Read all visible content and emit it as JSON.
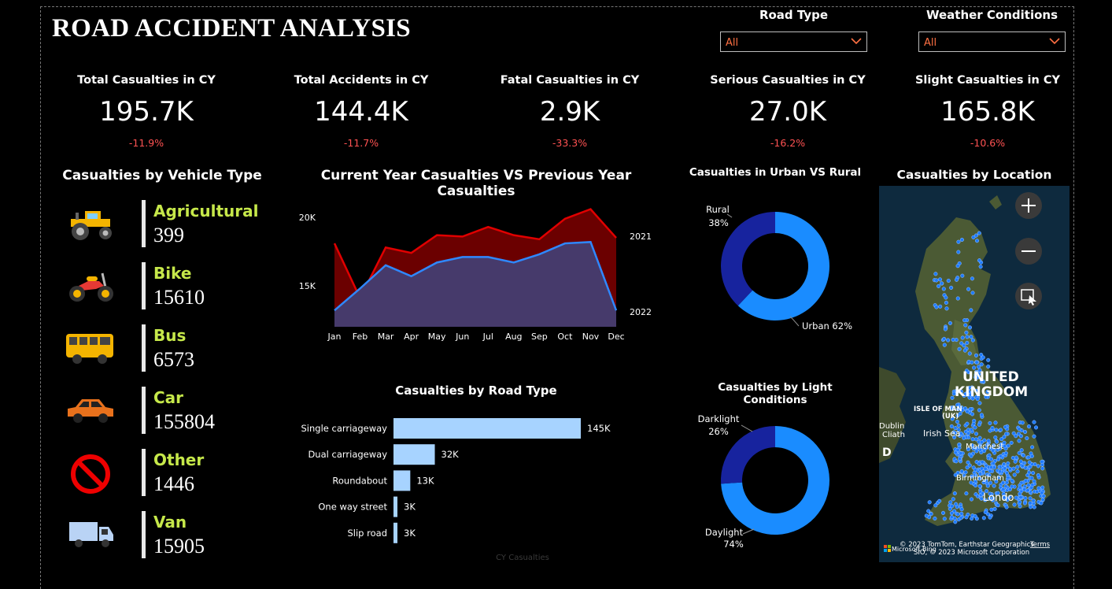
{
  "header": {
    "title": "ROAD ACCIDENT ANALYSIS"
  },
  "filters": [
    {
      "label": "Road Type",
      "value": "All"
    },
    {
      "label": "Weather Conditions",
      "value": "All"
    }
  ],
  "kpis": [
    {
      "label": "Total Casualties in CY",
      "value": "195.7K",
      "delta": "-11.9%"
    },
    {
      "label": "Total Accidents in CY",
      "value": "144.4K",
      "delta": "-11.7%"
    },
    {
      "label": "Fatal Casualties in CY",
      "value": "2.9K",
      "delta": "-33.3%"
    },
    {
      "label": "Serious Casualties in CY",
      "value": "27.0K",
      "delta": "-16.2%"
    },
    {
      "label": "Slight Casualties in CY",
      "value": "165.8K",
      "delta": "-10.6%"
    }
  ],
  "vehicles": {
    "title": "Casualties by Vehicle Type",
    "items": [
      {
        "name": "Agricultural",
        "value": "399",
        "icon": "tractor-icon"
      },
      {
        "name": "Bike",
        "value": "15610",
        "icon": "motorbike-icon"
      },
      {
        "name": "Bus",
        "value": "6573",
        "icon": "bus-icon"
      },
      {
        "name": "Car",
        "value": "155804",
        "icon": "car-icon"
      },
      {
        "name": "Other",
        "value": "1446",
        "icon": "prohibited-icon"
      },
      {
        "name": "Van",
        "value": "15905",
        "icon": "van-icon"
      }
    ]
  },
  "chart_data": [
    {
      "type": "area",
      "title": "Current Year Casualties VS Previous Year Casualties",
      "categories": [
        "Jan",
        "Feb",
        "Mar",
        "Apr",
        "May",
        "Jun",
        "Jul",
        "Aug",
        "Sep",
        "Oct",
        "Nov",
        "Dec"
      ],
      "series": [
        {
          "name": "2021",
          "color": "#e00000",
          "fill": "#6b0000",
          "values": [
            18100,
            14100,
            17800,
            17400,
            18700,
            18600,
            19300,
            18700,
            18400,
            19900,
            20600,
            18500
          ]
        },
        {
          "name": "2022",
          "color": "#2f88ff",
          "fill": "#463a6b",
          "values": [
            13200,
            14800,
            16500,
            15700,
            16700,
            17100,
            17100,
            16700,
            17300,
            18100,
            18200,
            13200
          ]
        }
      ],
      "y_ticks": [
        15000,
        20000
      ],
      "y_tick_labels": [
        "15K",
        "20K"
      ],
      "ylim": [
        12000,
        21500
      ]
    },
    {
      "type": "bar",
      "orientation": "horizontal",
      "title": "Casualties by Road Type",
      "categories": [
        "Single carriageway",
        "Dual carriageway",
        "Roundabout",
        "One way street",
        "Slip road"
      ],
      "values": [
        145000,
        32000,
        13000,
        3000,
        3000
      ],
      "value_labels": [
        "145K",
        "32K",
        "13K",
        "3K",
        "3K"
      ],
      "xlabel": "CY Casualties",
      "color": "#a7d3ff"
    },
    {
      "type": "pie",
      "donut": true,
      "title": "Casualties in Urban VS Rural",
      "slices": [
        {
          "label": "Urban",
          "value": 62,
          "label_text": "Urban 62%",
          "color": "#1a8cff"
        },
        {
          "label": "Rural",
          "value": 38,
          "label_text": "38%",
          "color": "#17239e"
        }
      ]
    },
    {
      "type": "pie",
      "donut": true,
      "title": "Casualties by Light Conditions",
      "slices": [
        {
          "label": "Daylight",
          "value": 74,
          "label_text": "74%",
          "color": "#1a8cff"
        },
        {
          "label": "Darklight",
          "value": 26,
          "label_text": "26%",
          "color": "#17239e"
        }
      ]
    }
  ],
  "map": {
    "title": "Casualties by Location",
    "labels": {
      "country": "UNITED",
      "country2": "KINGDOM",
      "isle": "ISLE OF MAN",
      "isle_sub": "(UK)",
      "dublin": "Dublin",
      "cliath": "Cliath",
      "irish_sea": "Irish Sea",
      "manchester": "Manchest",
      "birmingham": "Birmingham",
      "london": "Londo",
      "d": "D"
    },
    "attribution": "© 2023 TomTom, Earthstar Geographics",
    "attribution2": "SIO, © 2023 Microsoft Corporation",
    "terms": "Terms",
    "brand": "Microsoft Bing",
    "controls": [
      "zoom-in",
      "zoom-out",
      "select"
    ]
  }
}
